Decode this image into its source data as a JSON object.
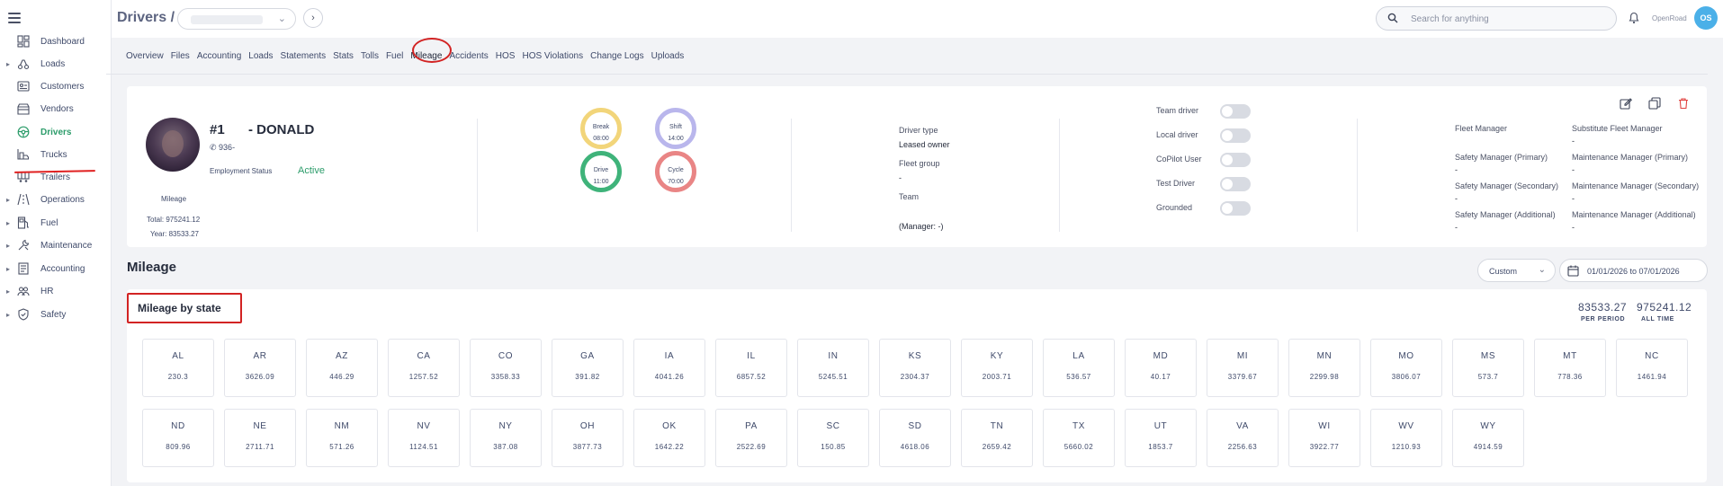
{
  "sidebar": {
    "items": [
      {
        "label": "Dashboard",
        "icon": "dashboard-icon",
        "caret": false
      },
      {
        "label": "Loads",
        "icon": "loads-icon",
        "caret": true
      },
      {
        "label": "Customers",
        "icon": "customers-icon",
        "caret": false
      },
      {
        "label": "Vendors",
        "icon": "vendors-icon",
        "caret": false
      },
      {
        "label": "Drivers",
        "icon": "drivers-icon",
        "caret": false,
        "active": true
      },
      {
        "label": "Trucks",
        "icon": "trucks-icon",
        "caret": false
      },
      {
        "label": "Trailers",
        "icon": "trailers-icon",
        "caret": false
      },
      {
        "label": "Operations",
        "icon": "operations-icon",
        "caret": true
      },
      {
        "label": "Fuel",
        "icon": "fuel-icon",
        "caret": true
      },
      {
        "label": "Maintenance",
        "icon": "maintenance-icon",
        "caret": true
      },
      {
        "label": "Accounting",
        "icon": "accounting-icon",
        "caret": true
      },
      {
        "label": "HR",
        "icon": "hr-icon",
        "caret": true
      },
      {
        "label": "Safety",
        "icon": "safety-icon",
        "caret": true
      }
    ]
  },
  "header": {
    "title": "Drivers /",
    "search_placeholder": "Search for anything",
    "company": "OpenRoad",
    "avatar_initials": "OS"
  },
  "tabs": [
    "Overview",
    "Files",
    "Accounting",
    "Loads",
    "Statements",
    "Stats",
    "Tolls",
    "Fuel",
    "Mileage",
    "Accidents",
    "HOS",
    "HOS Violations",
    "Change Logs",
    "Uploads"
  ],
  "active_tab": "Mileage",
  "driver": {
    "number": "#1",
    "name": "- DONALD",
    "phone": "936-",
    "employment_status_label": "Employment Status",
    "employment_status": "Active",
    "mileage_label": "Mileage",
    "mileage_total": "Total: 975241.12",
    "mileage_year": "Year: 83533.27"
  },
  "hos": [
    {
      "label": "Break",
      "value": "08:00",
      "color": "#f2d57a"
    },
    {
      "label": "Shift",
      "value": "14:00",
      "color": "#b9b6ec"
    },
    {
      "label": "Drive",
      "value": "11:00",
      "color": "#3fb37a"
    },
    {
      "label": "Cycle",
      "value": "70:00",
      "color": "#e98585"
    }
  ],
  "info": {
    "driver_type_label": "Driver type",
    "driver_type": "Leased owner",
    "fleet_group_label": "Fleet group",
    "fleet_group": "-",
    "team_label": "Team",
    "team_manager": "(Manager: -)"
  },
  "toggles": [
    {
      "label": "Team driver",
      "on": false
    },
    {
      "label": "Local driver",
      "on": false
    },
    {
      "label": "CoPilot User",
      "on": false
    },
    {
      "label": "Test Driver",
      "on": false
    },
    {
      "label": "Grounded",
      "on": false
    }
  ],
  "managers": {
    "fleet_manager_label": "Fleet Manager",
    "substitute_fleet_manager_label": "Substitute Fleet Manager",
    "substitute_fleet_manager": "-",
    "safety_primary_label": "Safety Manager (Primary)",
    "safety_primary": "-",
    "maint_primary_label": "Maintenance Manager (Primary)",
    "maint_primary": "-",
    "safety_secondary_label": "Safety Manager (Secondary)",
    "safety_secondary": "-",
    "maint_secondary_label": "Maintenance Manager (Secondary)",
    "maint_secondary": "-",
    "safety_additional_label": "Safety Manager (Additional)",
    "safety_additional": "-",
    "maint_additional_label": "Maintenance Manager (Additional)",
    "maint_additional": "-"
  },
  "mileage": {
    "title": "Mileage",
    "range": "Custom",
    "date_range": "01/01/2026 to 07/01/2026",
    "by_state_title": "Mileage by state",
    "period_total": "83533.27",
    "period_label": "PER PERIOD",
    "all_total": "975241.12",
    "all_label": "ALL TIME",
    "states": [
      {
        "code": "AL",
        "miles": "230.3"
      },
      {
        "code": "AR",
        "miles": "3626.09"
      },
      {
        "code": "AZ",
        "miles": "446.29"
      },
      {
        "code": "CA",
        "miles": "1257.52"
      },
      {
        "code": "CO",
        "miles": "3358.33"
      },
      {
        "code": "GA",
        "miles": "391.82"
      },
      {
        "code": "IA",
        "miles": "4041.26"
      },
      {
        "code": "IL",
        "miles": "6857.52"
      },
      {
        "code": "IN",
        "miles": "5245.51"
      },
      {
        "code": "KS",
        "miles": "2304.37"
      },
      {
        "code": "KY",
        "miles": "2003.71"
      },
      {
        "code": "LA",
        "miles": "536.57"
      },
      {
        "code": "MD",
        "miles": "40.17"
      },
      {
        "code": "MI",
        "miles": "3379.67"
      },
      {
        "code": "MN",
        "miles": "2299.98"
      },
      {
        "code": "MO",
        "miles": "3806.07"
      },
      {
        "code": "MS",
        "miles": "573.7"
      },
      {
        "code": "MT",
        "miles": "778.36"
      },
      {
        "code": "NC",
        "miles": "1461.94"
      },
      {
        "code": "ND",
        "miles": "809.96"
      },
      {
        "code": "NE",
        "miles": "2711.71"
      },
      {
        "code": "NM",
        "miles": "571.26"
      },
      {
        "code": "NV",
        "miles": "1124.51"
      },
      {
        "code": "NY",
        "miles": "387.08"
      },
      {
        "code": "OH",
        "miles": "3877.73"
      },
      {
        "code": "OK",
        "miles": "1642.22"
      },
      {
        "code": "PA",
        "miles": "2522.69"
      },
      {
        "code": "SC",
        "miles": "150.85"
      },
      {
        "code": "SD",
        "miles": "4618.06"
      },
      {
        "code": "TN",
        "miles": "2659.42"
      },
      {
        "code": "TX",
        "miles": "5660.02"
      },
      {
        "code": "UT",
        "miles": "1853.7"
      },
      {
        "code": "VA",
        "miles": "2256.63"
      },
      {
        "code": "WI",
        "miles": "3922.77"
      },
      {
        "code": "WV",
        "miles": "1210.93"
      },
      {
        "code": "WY",
        "miles": "4914.59"
      }
    ]
  }
}
